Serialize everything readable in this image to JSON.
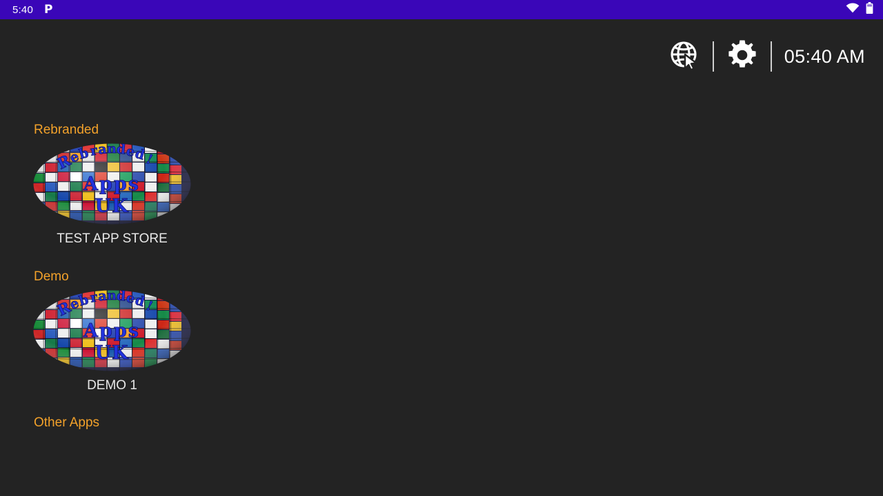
{
  "status_bar": {
    "clock": "5:40",
    "notification_glyph": "P",
    "icons": [
      "wifi-icon",
      "battery-icon"
    ],
    "background_color": "#3A06B8"
  },
  "app_bar": {
    "globe_cursor_icon": "globe-cursor-icon",
    "settings_icon": "gear-icon",
    "time": "05:40 AM"
  },
  "theme": {
    "background_color": "#232323",
    "section_header_color": "#F2A12A",
    "label_color": "#E8E8E8"
  },
  "logo": {
    "name": "rebranded-apps-uk-logo",
    "text_line_1": "Rebranded",
    "text_line_2": "Apps",
    "text_line_3": "UK",
    "text_color": "#2233DD"
  },
  "sections": [
    {
      "header": "Rebranded",
      "apps": [
        {
          "label": "TEST APP STORE"
        }
      ]
    },
    {
      "header": "Demo",
      "apps": [
        {
          "label": "DEMO 1"
        }
      ]
    },
    {
      "header": "Other Apps",
      "apps": []
    }
  ]
}
